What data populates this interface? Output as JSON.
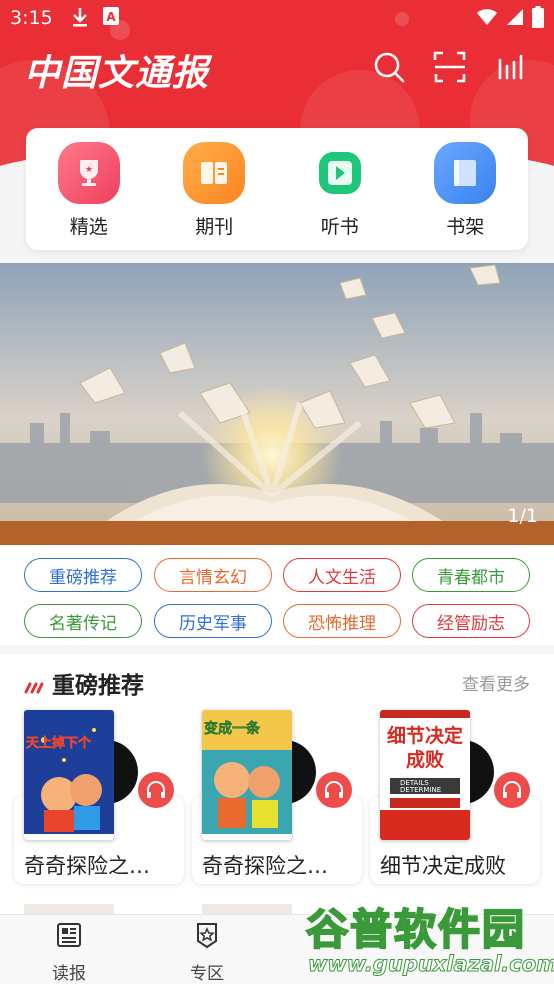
{
  "status": {
    "time": "3:15"
  },
  "app": {
    "logo": "中国文通报"
  },
  "header": {
    "icons": [
      "search-icon",
      "scan-icon",
      "chart-icon"
    ]
  },
  "quicknav": [
    {
      "label": "精选",
      "icon": "trophy-icon",
      "color": "#f2506a"
    },
    {
      "label": "期刊",
      "icon": "journal-icon",
      "color": "#fb8f28"
    },
    {
      "label": "听书",
      "icon": "play-icon",
      "color": "#1ec77a"
    },
    {
      "label": "书架",
      "icon": "bookshelf-icon",
      "color": "#3f8ef5"
    }
  ],
  "banner": {
    "counter": "1/1"
  },
  "tags": [
    {
      "label": "重磅推荐",
      "color": "#2d6fd8"
    },
    {
      "label": "言情玄幻",
      "color": "#e8692c"
    },
    {
      "label": "人文生活",
      "color": "#e0393e"
    },
    {
      "label": "青春都市",
      "color": "#3a9a3a"
    },
    {
      "label": "名著传记",
      "color": "#3a9a3a"
    },
    {
      "label": "历史军事",
      "color": "#2d6fd8"
    },
    {
      "label": "恐怖推理",
      "color": "#e8692c"
    },
    {
      "label": "经管励志",
      "color": "#e0393e"
    }
  ],
  "section": {
    "title": "重磅推荐",
    "more": "查看更多",
    "books": [
      {
        "title": "奇奇探险之…",
        "cover_text": "天上掉下个"
      },
      {
        "title": "奇奇探险之…",
        "cover_text": "变成一条"
      },
      {
        "title": "细节决定成败",
        "cover_text": "细节决定成败",
        "cover_sub": "DETAILS DETERMINE"
      }
    ]
  },
  "bottomnav": [
    {
      "label": "读报",
      "icon": "newspaper-icon"
    },
    {
      "label": "专区",
      "icon": "badge-icon"
    }
  ],
  "watermark": {
    "title": "谷普软件园",
    "url": "www.gupuxlazal.com"
  }
}
